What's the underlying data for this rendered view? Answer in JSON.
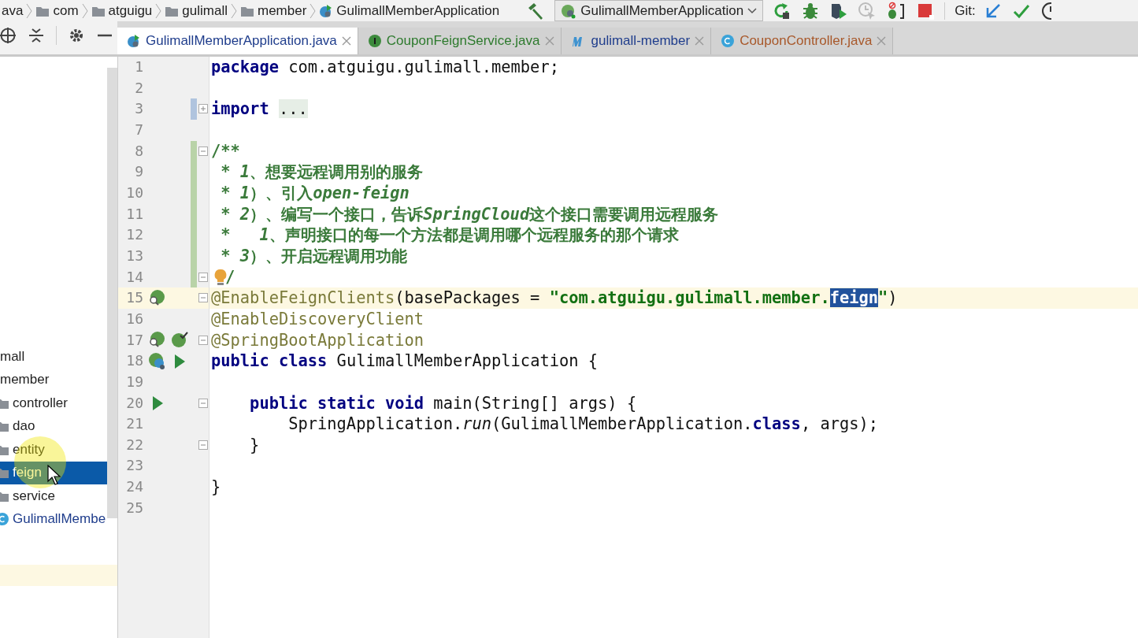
{
  "breadcrumbs": [
    {
      "label": "ava",
      "kind": "plain"
    },
    {
      "label": "com",
      "kind": "folder"
    },
    {
      "label": "atguigu",
      "kind": "folder"
    },
    {
      "label": "gulimall",
      "kind": "folder"
    },
    {
      "label": "member",
      "kind": "folder"
    },
    {
      "label": "GulimallMemberApplication",
      "kind": "spring-class"
    }
  ],
  "toolbar": {
    "run_config": "GulimallMemberApplication",
    "git_label": "Git:"
  },
  "tabs": [
    {
      "label": "GulimallMemberApplication.java",
      "kind": "spring-class",
      "selected": true
    },
    {
      "label": "CouponFeignService.java",
      "kind": "interface",
      "selected": false
    },
    {
      "label": "gulimall-member",
      "kind": "maven",
      "selected": false
    },
    {
      "label": "CouponController.java",
      "kind": "class",
      "selected": false
    }
  ],
  "project_tree": {
    "items": [
      {
        "label": "mall",
        "selected": false
      },
      {
        "label": "member",
        "selected": false,
        "children": [
          {
            "label": "controller",
            "kind": "folder",
            "selected": false
          },
          {
            "label": "dao",
            "kind": "folder",
            "selected": false
          },
          {
            "label": "entity",
            "kind": "folder",
            "selected": false
          },
          {
            "label": "feign",
            "kind": "folder",
            "selected": true
          },
          {
            "label": "service",
            "kind": "folder",
            "selected": false
          },
          {
            "label": "GulimallMembe",
            "kind": "class",
            "selected": false
          }
        ]
      }
    ]
  },
  "editor": {
    "lines": [
      {
        "number": "1",
        "segments": [
          {
            "text": "package",
            "kind": "keyword"
          },
          {
            "text": " com.atguigu.gulimall.member;",
            "kind": "plain"
          }
        ]
      },
      {
        "number": "2"
      },
      {
        "number": "3",
        "fold": {
          "collapsed": true
        },
        "change": {
          "color": "#b0c4de"
        },
        "segments": [
          {
            "text": "import",
            "kind": "keyword"
          },
          {
            "text": "...",
            "kind": "folded"
          }
        ]
      },
      {
        "number": "7"
      },
      {
        "number": "8",
        "fold": {
          "collapsed": false
        },
        "change": {
          "color": "#b9d3a8"
        },
        "segments": [
          {
            "text": "/**",
            "kind": "doc"
          }
        ]
      },
      {
        "number": "9",
        "change": {
          "color": "#b9d3a8"
        },
        "segments": [
          {
            "text": " * ",
            "kind": "doc"
          },
          {
            "text": "1",
            "kind": "doc-italic"
          },
          {
            "text": "、想要远程调用别的服务",
            "kind": "doc"
          }
        ]
      },
      {
        "number": "10",
        "change": {
          "color": "#b9d3a8"
        },
        "segments": [
          {
            "text": " * ",
            "kind": "doc"
          },
          {
            "text": "1",
            "kind": "doc-italic"
          },
          {
            "text": "）、引入",
            "kind": "doc"
          },
          {
            "text": "open-feign",
            "kind": "doc-italic"
          }
        ]
      },
      {
        "number": "11",
        "change": {
          "color": "#b9d3a8"
        },
        "segments": [
          {
            "text": " * ",
            "kind": "doc"
          },
          {
            "text": "2",
            "kind": "doc-italic"
          },
          {
            "text": "）、编写一个接口，告诉",
            "kind": "doc"
          },
          {
            "text": "SpringCloud",
            "kind": "doc-italic"
          },
          {
            "text": "这个接口需要调用远程服务",
            "kind": "doc"
          }
        ]
      },
      {
        "number": "12",
        "change": {
          "color": "#b9d3a8"
        },
        "segments": [
          {
            "text": " *   ",
            "kind": "doc"
          },
          {
            "text": "1",
            "kind": "doc-italic"
          },
          {
            "text": "、声明接口的每一个方法都是调用哪个远程服务的那个请求",
            "kind": "doc"
          }
        ]
      },
      {
        "number": "13",
        "change": {
          "color": "#b9d3a8"
        },
        "segments": [
          {
            "text": " * ",
            "kind": "doc"
          },
          {
            "text": "3",
            "kind": "doc-italic"
          },
          {
            "text": "）、开启远程调用功能",
            "kind": "doc"
          }
        ]
      },
      {
        "number": "14",
        "fold": {
          "collapsed": false
        },
        "change": {
          "color": "#b9d3a8"
        },
        "bulb": true,
        "segments": [
          {
            "text": "/",
            "kind": "doc"
          }
        ]
      },
      {
        "number": "15",
        "fold": {
          "collapsed": false
        },
        "current": true,
        "gutter_icons": [
          {
            "kind": "bean-search"
          }
        ],
        "segments": [
          {
            "text": "@EnableFeignClients",
            "kind": "annotation"
          },
          {
            "text": "(basePackages = ",
            "kind": "plain"
          },
          {
            "text": "\"com.atguigu.gulimall.member.",
            "kind": "string"
          },
          {
            "text": "feign",
            "kind": "string-selected"
          },
          {
            "text": "\"",
            "kind": "string"
          },
          {
            "text": ")",
            "kind": "plain"
          }
        ]
      },
      {
        "number": "16",
        "segments": [
          {
            "text": "@EnableDiscoveryClient",
            "kind": "annotation"
          }
        ]
      },
      {
        "number": "17",
        "fold": {
          "collapsed": false
        },
        "gutter_icons": [
          {
            "kind": "bean-search"
          },
          {
            "kind": "bean-check"
          }
        ],
        "segments": [
          {
            "text": "@SpringBootApplication",
            "kind": "annotation"
          }
        ]
      },
      {
        "number": "18",
        "gutter_icons": [
          {
            "kind": "spring-class"
          },
          {
            "kind": "run"
          }
        ],
        "segments": [
          {
            "text": "public class",
            "kind": "keyword"
          },
          {
            "text": " GulimallMemberApplication {",
            "kind": "plain"
          }
        ]
      },
      {
        "number": "19"
      },
      {
        "number": "20",
        "fold": {
          "collapsed": false
        },
        "gutter_icons": [
          {
            "kind": "run"
          }
        ],
        "segments": [
          {
            "text": "    public static void",
            "kind": "keyword"
          },
          {
            "text": " main(String[] args) {",
            "kind": "plain"
          }
        ]
      },
      {
        "number": "21",
        "segments": [
          {
            "text": "        SpringApplication.",
            "kind": "plain"
          },
          {
            "text": "run",
            "kind": "italic"
          },
          {
            "text": "(GulimallMemberApplication.",
            "kind": "plain"
          },
          {
            "text": "class",
            "kind": "keyword"
          },
          {
            "text": ", args);",
            "kind": "plain"
          }
        ]
      },
      {
        "number": "22",
        "fold": {
          "collapsed": false
        },
        "segments": [
          {
            "text": "    }",
            "kind": "plain"
          }
        ]
      },
      {
        "number": "23"
      },
      {
        "number": "24",
        "segments": [
          {
            "text": "}",
            "kind": "plain"
          }
        ]
      },
      {
        "number": "25"
      }
    ]
  }
}
